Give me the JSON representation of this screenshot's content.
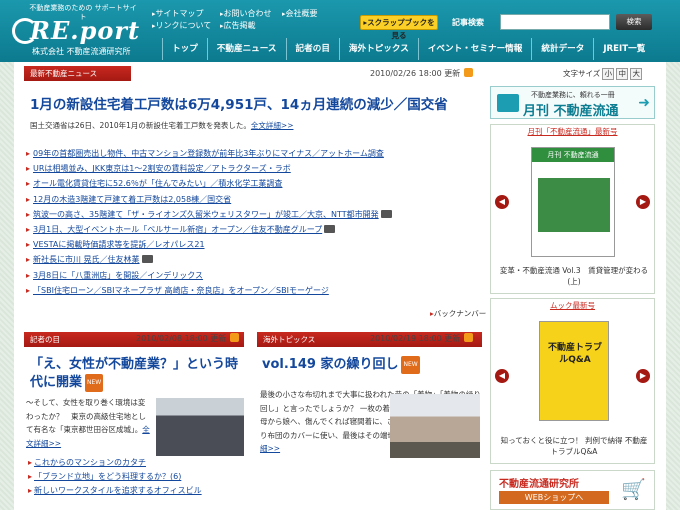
{
  "header": {
    "tagline": "不動産業務のための サポートサイト",
    "logo": "RE.port",
    "company": "株式会社 不動産流通研究所",
    "util_links": [
      "サイトマップ",
      "リンクについて",
      "お問い合わせ",
      "広告掲載",
      "会社概要"
    ],
    "scrap_button": "▸スクラップブックを見る",
    "search_label": "記事検索",
    "search_button": "検索"
  },
  "nav": [
    "トップ",
    "不動産ニュース",
    "記者の目",
    "海外トピックス",
    "イベント・セミナー情報",
    "統計データ",
    "JREIT一覧"
  ],
  "news": {
    "header": "最新不動産ニュース",
    "date": "2010/02/26 18:00 更新",
    "headline": "1月の新設住宅着工戸数は6万4,951戸、14ヵ月連続の減少／国交省",
    "summary": "国土交通省は26日、2010年1月の新設住宅着工戸数を発表した。",
    "summary_link": "全文詳細>>",
    "items": [
      "09年の首都圏売出し物件、中古マンション登録数が前年比3年ぶりにマイナス／アットホーム調査",
      "URは相場並み、JKK東京は1～2割安の賃料設定／アトラクターズ・ラボ",
      "オール電化賃貸住宅に52.6％が「住んでみたい」／積水化学工業調査",
      "12月の木造3階建て戸建て着工戸数は2,058棟／国交省",
      "筑波一の高さ、35階建て「ザ・ライオンズ久留米ウェリスタワー」が竣工／大京、NTT都市開発",
      "3月1日、大型イベントホール「ベルサール新宿」オープン／住友不動産グループ",
      "VESTAに掲載時価請求等を提訴／レオパレス21",
      "新社長に市川 晃氏／住友林業",
      "3月8日に「八重洲店」を開設／インデリックス",
      "「SBI住宅ローン／SBIマネープラザ 高崎店・奈良店」をオープン／SBIモーゲージ"
    ],
    "back_number": "バックナンバー"
  },
  "kisha": {
    "header": "記者の目",
    "date": "2010/02/08 18:00 更新",
    "title": "「え、女性が不動産業？」という時代に開業",
    "new_badge": "NEW",
    "body": "～そして、女性を取り巻く環境は変わったか？　東京の高級住宅地として有名な「東京都世田谷区成城」。",
    "more": "全文詳細>>",
    "links": [
      "これからのマンションのカタチ",
      "「ブランド立地」をどう料理するか？(6)",
      "新しいワークスタイルを追求するオフィスビル"
    ]
  },
  "kaigai": {
    "header": "海外トピックス",
    "date": "2010/02/19 18:00 更新",
    "title": "vol.149 家の繰り回し",
    "new_badge": "NEW",
    "body": "最後の小さな布切れまで大事に扱われた昔の「着物」「着物の繰り回し」と言ったでしょうか？ 一枚の着物を染め替え仕立て直して母から娘へ、傷んでくれば寝間着に、さらに切ってのれんにしたり布団のカバーに使い、最後はその端切れで小物を作る。",
    "more": "全文詳細>>"
  },
  "sidebar": {
    "font_size_label": "文字サイズ",
    "font_sizes": [
      "小",
      "中",
      "大"
    ],
    "banner_small": "不動産業務に、頼れる一冊",
    "banner_big": "月刊 不動産流通",
    "magazine_title": "月刊「不動産流通」最新号",
    "magazine_cover_title": "月刊 不動産流通",
    "magazine_caption": "変革・不動産流通 Vol.3　賃貸管理が変わる(上)",
    "mook_title": "ムック最新号",
    "mook_cover_title": "不動産トラブルQ&A",
    "mook_caption": "知っておくと役に立つ！ 判例で納得 不動産トラブルQ&A",
    "shop_line1": "不動産流通研究所",
    "shop_line2": "WEBショップへ"
  }
}
